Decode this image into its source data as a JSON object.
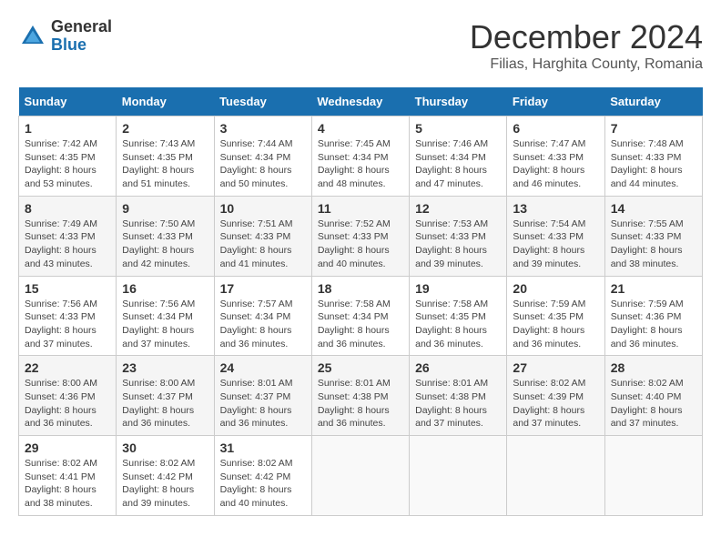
{
  "logo": {
    "general": "General",
    "blue": "Blue"
  },
  "title": "December 2024",
  "subtitle": "Filias, Harghita County, Romania",
  "days_header": [
    "Sunday",
    "Monday",
    "Tuesday",
    "Wednesday",
    "Thursday",
    "Friday",
    "Saturday"
  ],
  "weeks": [
    [
      {
        "day": "1",
        "sunrise": "Sunrise: 7:42 AM",
        "sunset": "Sunset: 4:35 PM",
        "daylight": "Daylight: 8 hours and 53 minutes."
      },
      {
        "day": "2",
        "sunrise": "Sunrise: 7:43 AM",
        "sunset": "Sunset: 4:35 PM",
        "daylight": "Daylight: 8 hours and 51 minutes."
      },
      {
        "day": "3",
        "sunrise": "Sunrise: 7:44 AM",
        "sunset": "Sunset: 4:34 PM",
        "daylight": "Daylight: 8 hours and 50 minutes."
      },
      {
        "day": "4",
        "sunrise": "Sunrise: 7:45 AM",
        "sunset": "Sunset: 4:34 PM",
        "daylight": "Daylight: 8 hours and 48 minutes."
      },
      {
        "day": "5",
        "sunrise": "Sunrise: 7:46 AM",
        "sunset": "Sunset: 4:34 PM",
        "daylight": "Daylight: 8 hours and 47 minutes."
      },
      {
        "day": "6",
        "sunrise": "Sunrise: 7:47 AM",
        "sunset": "Sunset: 4:33 PM",
        "daylight": "Daylight: 8 hours and 46 minutes."
      },
      {
        "day": "7",
        "sunrise": "Sunrise: 7:48 AM",
        "sunset": "Sunset: 4:33 PM",
        "daylight": "Daylight: 8 hours and 44 minutes."
      }
    ],
    [
      {
        "day": "8",
        "sunrise": "Sunrise: 7:49 AM",
        "sunset": "Sunset: 4:33 PM",
        "daylight": "Daylight: 8 hours and 43 minutes."
      },
      {
        "day": "9",
        "sunrise": "Sunrise: 7:50 AM",
        "sunset": "Sunset: 4:33 PM",
        "daylight": "Daylight: 8 hours and 42 minutes."
      },
      {
        "day": "10",
        "sunrise": "Sunrise: 7:51 AM",
        "sunset": "Sunset: 4:33 PM",
        "daylight": "Daylight: 8 hours and 41 minutes."
      },
      {
        "day": "11",
        "sunrise": "Sunrise: 7:52 AM",
        "sunset": "Sunset: 4:33 PM",
        "daylight": "Daylight: 8 hours and 40 minutes."
      },
      {
        "day": "12",
        "sunrise": "Sunrise: 7:53 AM",
        "sunset": "Sunset: 4:33 PM",
        "daylight": "Daylight: 8 hours and 39 minutes."
      },
      {
        "day": "13",
        "sunrise": "Sunrise: 7:54 AM",
        "sunset": "Sunset: 4:33 PM",
        "daylight": "Daylight: 8 hours and 39 minutes."
      },
      {
        "day": "14",
        "sunrise": "Sunrise: 7:55 AM",
        "sunset": "Sunset: 4:33 PM",
        "daylight": "Daylight: 8 hours and 38 minutes."
      }
    ],
    [
      {
        "day": "15",
        "sunrise": "Sunrise: 7:56 AM",
        "sunset": "Sunset: 4:33 PM",
        "daylight": "Daylight: 8 hours and 37 minutes."
      },
      {
        "day": "16",
        "sunrise": "Sunrise: 7:56 AM",
        "sunset": "Sunset: 4:34 PM",
        "daylight": "Daylight: 8 hours and 37 minutes."
      },
      {
        "day": "17",
        "sunrise": "Sunrise: 7:57 AM",
        "sunset": "Sunset: 4:34 PM",
        "daylight": "Daylight: 8 hours and 36 minutes."
      },
      {
        "day": "18",
        "sunrise": "Sunrise: 7:58 AM",
        "sunset": "Sunset: 4:34 PM",
        "daylight": "Daylight: 8 hours and 36 minutes."
      },
      {
        "day": "19",
        "sunrise": "Sunrise: 7:58 AM",
        "sunset": "Sunset: 4:35 PM",
        "daylight": "Daylight: 8 hours and 36 minutes."
      },
      {
        "day": "20",
        "sunrise": "Sunrise: 7:59 AM",
        "sunset": "Sunset: 4:35 PM",
        "daylight": "Daylight: 8 hours and 36 minutes."
      },
      {
        "day": "21",
        "sunrise": "Sunrise: 7:59 AM",
        "sunset": "Sunset: 4:36 PM",
        "daylight": "Daylight: 8 hours and 36 minutes."
      }
    ],
    [
      {
        "day": "22",
        "sunrise": "Sunrise: 8:00 AM",
        "sunset": "Sunset: 4:36 PM",
        "daylight": "Daylight: 8 hours and 36 minutes."
      },
      {
        "day": "23",
        "sunrise": "Sunrise: 8:00 AM",
        "sunset": "Sunset: 4:37 PM",
        "daylight": "Daylight: 8 hours and 36 minutes."
      },
      {
        "day": "24",
        "sunrise": "Sunrise: 8:01 AM",
        "sunset": "Sunset: 4:37 PM",
        "daylight": "Daylight: 8 hours and 36 minutes."
      },
      {
        "day": "25",
        "sunrise": "Sunrise: 8:01 AM",
        "sunset": "Sunset: 4:38 PM",
        "daylight": "Daylight: 8 hours and 36 minutes."
      },
      {
        "day": "26",
        "sunrise": "Sunrise: 8:01 AM",
        "sunset": "Sunset: 4:38 PM",
        "daylight": "Daylight: 8 hours and 37 minutes."
      },
      {
        "day": "27",
        "sunrise": "Sunrise: 8:02 AM",
        "sunset": "Sunset: 4:39 PM",
        "daylight": "Daylight: 8 hours and 37 minutes."
      },
      {
        "day": "28",
        "sunrise": "Sunrise: 8:02 AM",
        "sunset": "Sunset: 4:40 PM",
        "daylight": "Daylight: 8 hours and 37 minutes."
      }
    ],
    [
      {
        "day": "29",
        "sunrise": "Sunrise: 8:02 AM",
        "sunset": "Sunset: 4:41 PM",
        "daylight": "Daylight: 8 hours and 38 minutes."
      },
      {
        "day": "30",
        "sunrise": "Sunrise: 8:02 AM",
        "sunset": "Sunset: 4:42 PM",
        "daylight": "Daylight: 8 hours and 39 minutes."
      },
      {
        "day": "31",
        "sunrise": "Sunrise: 8:02 AM",
        "sunset": "Sunset: 4:42 PM",
        "daylight": "Daylight: 8 hours and 40 minutes."
      },
      null,
      null,
      null,
      null
    ]
  ]
}
